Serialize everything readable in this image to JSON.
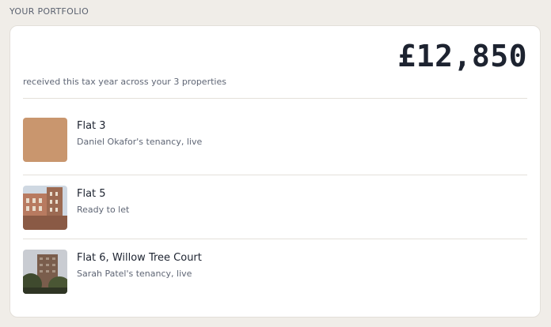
{
  "portfolio": {
    "section_label": "YOUR PORTFOLIO",
    "total": "£12,850",
    "summary": "received this tax year across your 3 properties"
  },
  "properties": [
    {
      "name": "Flat 3",
      "status": "Daniel Okafor's tenancy, live",
      "thumb_color": "#c9966e"
    },
    {
      "name": "Flat 5",
      "status": "Ready to let",
      "thumb_color": "#b8836a"
    },
    {
      "name": "Flat 6, Willow Tree Court",
      "status": "Sarah Patel's tenancy, live",
      "thumb_color": "#5a4a3c"
    }
  ]
}
